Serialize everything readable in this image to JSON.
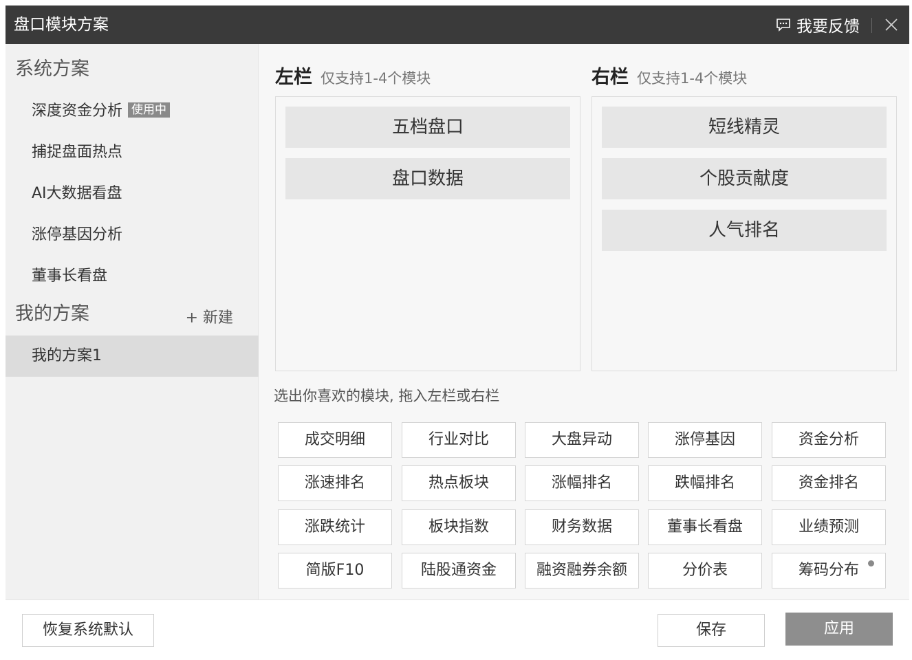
{
  "window": {
    "title": "盘口模块方案",
    "feedback_label": "我要反馈",
    "feedback_icon": "chat-bubble-icon",
    "close_icon": "close-icon"
  },
  "sidebar": {
    "system_title": "系统方案",
    "system_items": [
      {
        "label": "深度资金分析",
        "badge": "使用中"
      },
      {
        "label": "捕捉盘面热点"
      },
      {
        "label": "AI大数据看盘"
      },
      {
        "label": "涨停基因分析"
      },
      {
        "label": "董事长看盘"
      }
    ],
    "my_title": "我的方案",
    "new_label": "+ 新建",
    "my_items": [
      {
        "label": "我的方案1",
        "selected": true
      }
    ]
  },
  "left_column": {
    "title": "左栏",
    "subtitle": "仅支持1-4个模块",
    "modules": [
      "五档盘口",
      "盘口数据"
    ]
  },
  "right_column": {
    "title": "右栏",
    "subtitle": "仅支持1-4个模块",
    "modules": [
      "短线精灵",
      "个股贡献度",
      "人气排名"
    ]
  },
  "palette": {
    "hint": "选出你喜欢的模块, 拖入左栏或右栏",
    "items": [
      "成交明细",
      "行业对比",
      "大盘异动",
      "涨停基因",
      "资金分析",
      "涨速排名",
      "热点板块",
      "涨幅排名",
      "跌幅排名",
      "资金排名",
      "涨跌统计",
      "板块指数",
      "财务数据",
      "董事长看盘",
      "业绩预测",
      "简版F10",
      "陆股通资金",
      "融资融券余额",
      "分价表",
      "筹码分布"
    ],
    "new_dot_item": "筹码分布"
  },
  "footer": {
    "restore_label": "恢复系统默认",
    "save_label": "保存",
    "apply_label": "应用"
  },
  "colors": {
    "titlebar": "#3a3a3a",
    "sidebar_bg": "#f1f1f1",
    "selected_bg": "#dcdcdc",
    "module_bg": "#e6e6e6",
    "primary_button": "#8e8e8e"
  }
}
